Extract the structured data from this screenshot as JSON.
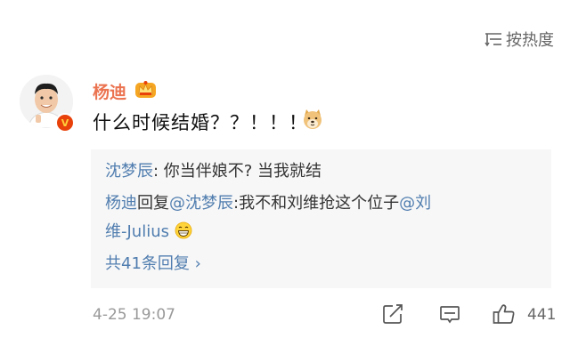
{
  "sort": {
    "label": "按热度",
    "icon": "sort-lines-icon"
  },
  "comment": {
    "username": "杨迪",
    "user_badge_icon": "vip-crown-badge-icon",
    "verified_icon": "verified-v-icon",
    "verified_letter": "V",
    "text": "什么时候结婚？？！！！",
    "emoji_icon": "doge-emoji-icon",
    "time": "4-25 19:07",
    "likes": "441",
    "accent_color": "#eb7350",
    "link_color": "#507daf"
  },
  "replies": [
    {
      "author": "沈梦辰",
      "text": ": 你当伴娘不? 当我就结"
    },
    {
      "author": "杨迪",
      "reply_word": "回复",
      "mention": "@沈梦辰",
      "text": ":我不和刘维抢这个位子",
      "mention2_part1": "@刘",
      "mention2_part2": "维-Julius",
      "emoji_icon": "laughing-emoji-icon"
    }
  ],
  "more_replies": "共41条回复 ›",
  "actions": {
    "share_icon": "share-edit-icon",
    "comment_icon": "comment-bubble-icon",
    "like_icon": "thumbs-up-icon"
  }
}
